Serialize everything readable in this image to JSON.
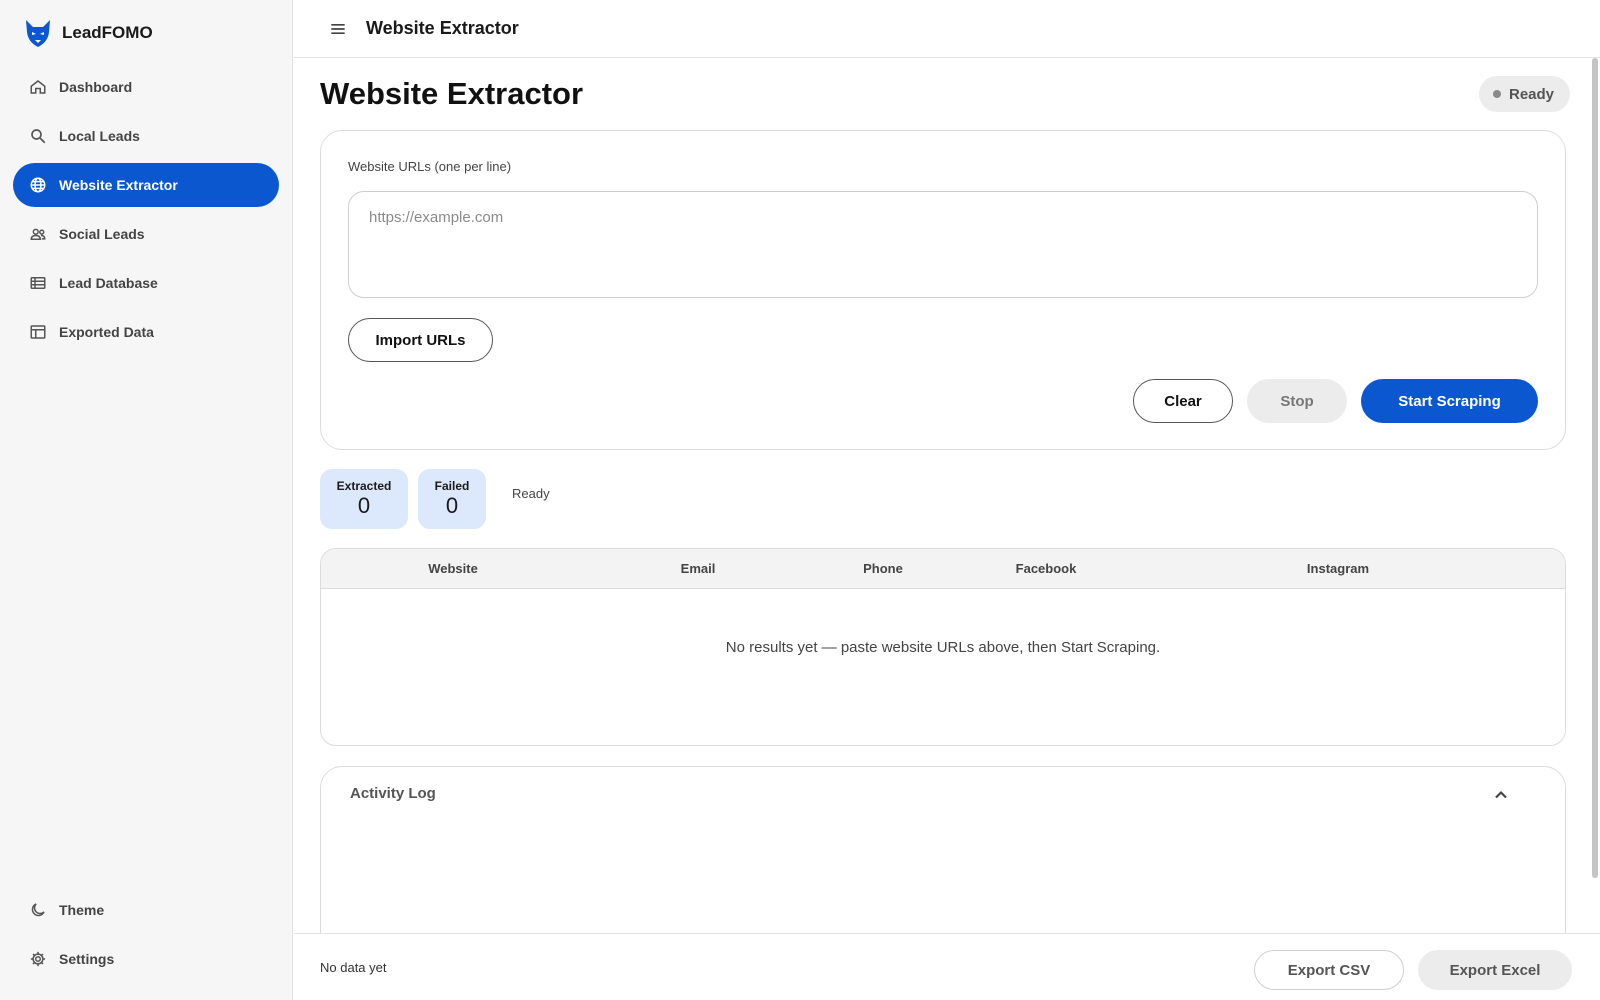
{
  "app": {
    "name": "LeadFOMO",
    "logo_icon": "fox-logo-icon",
    "accent": "#0b57d0"
  },
  "sidebar": {
    "items": [
      {
        "label": "Dashboard",
        "icon": "home-icon",
        "active": false
      },
      {
        "label": "Local Leads",
        "icon": "search-icon",
        "active": false
      },
      {
        "label": "Website Extractor",
        "icon": "globe-icon",
        "active": true
      },
      {
        "label": "Social Leads",
        "icon": "people-icon",
        "active": false
      },
      {
        "label": "Lead Database",
        "icon": "list-icon",
        "active": false
      },
      {
        "label": "Exported Data",
        "icon": "table-icon",
        "active": false
      }
    ],
    "bottom_items": [
      {
        "label": "Theme",
        "icon": "moon-icon"
      },
      {
        "label": "Settings",
        "icon": "gear-icon"
      }
    ]
  },
  "topbar": {
    "title": "Website Extractor",
    "menu_icon": "menu-icon"
  },
  "page": {
    "title": "Website Extractor",
    "status": "Ready"
  },
  "input_card": {
    "label": "Website URLs (one per line)",
    "value": "",
    "placeholder": "https://example.com",
    "import_label": "Import URLs",
    "clear_label": "Clear",
    "stop_label": "Stop",
    "start_label": "Start Scraping"
  },
  "stats": {
    "extracted_label": "Extracted",
    "extracted_value": "0",
    "failed_label": "Failed",
    "failed_value": "0",
    "progress_text": "Ready"
  },
  "results_table": {
    "columns": [
      "Website",
      "Email",
      "Phone",
      "Facebook",
      "Instagram"
    ],
    "rows": [],
    "empty_message": "No results yet — paste website URLs above, then Start Scraping."
  },
  "activity_log": {
    "title": "Activity Log",
    "toggle_icon": "chevron-up-icon",
    "entries": []
  },
  "footer": {
    "status": "No data yet",
    "export_csv_label": "Export CSV",
    "export_excel_label": "Export Excel"
  }
}
